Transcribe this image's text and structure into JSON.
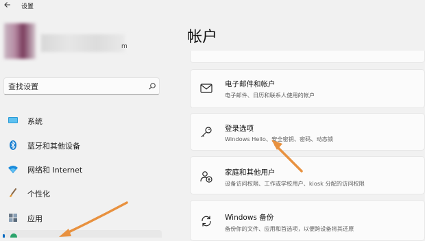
{
  "app": {
    "title": "设置"
  },
  "user": {
    "name_suffix": "m"
  },
  "search": {
    "placeholder": "查找设置"
  },
  "sidebar": {
    "items": [
      {
        "label": "系统",
        "icon": "monitor-icon"
      },
      {
        "label": "蓝牙和其他设备",
        "icon": "bluetooth-icon"
      },
      {
        "label": "网络和 Internet",
        "icon": "wifi-icon"
      },
      {
        "label": "个性化",
        "icon": "brush-icon"
      },
      {
        "label": "应用",
        "icon": "apps-icon"
      }
    ]
  },
  "main": {
    "title": "帐户",
    "cards": [
      {
        "title": "电子邮件和帐户",
        "subtitle": "电子邮件、日历和联系人使用的帐户",
        "icon": "mail-icon"
      },
      {
        "title": "登录选项",
        "subtitle": "Windows Hello、安全密钥、密码、动态锁",
        "icon": "key-icon"
      },
      {
        "title": "家庭和其他用户",
        "subtitle": "设备访问权限、工作或学校用户、kiosk 分配的访问权限",
        "icon": "family-icon"
      },
      {
        "title": "Windows 备份",
        "subtitle": "备份你的文件、应用和首选项，以便跨设备将其还原",
        "icon": "backup-icon"
      }
    ]
  },
  "colors": {
    "annotation_arrow": "#e8913f",
    "accent": "#0067c0"
  }
}
